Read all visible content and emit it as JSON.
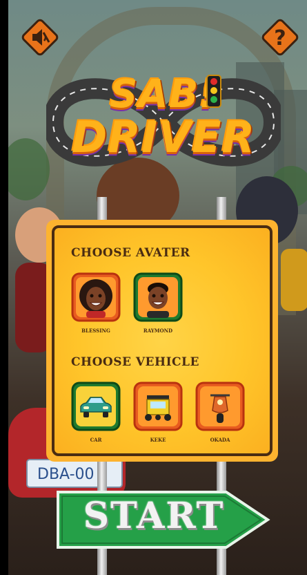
{
  "colors": {
    "board": "#fdb32f",
    "board_border": "#4a2c12",
    "start_green": "#25a048",
    "icon_orange": "#e8731a"
  },
  "top_bar": {
    "sound_button_icon": "speaker-muted-icon",
    "help_button_icon": "question-mark-icon",
    "help_glyph": "?"
  },
  "logo": {
    "line1": "SAB!",
    "line2": "DRIVER"
  },
  "background": {
    "plate_text": "DBA-00"
  },
  "avatar_section": {
    "title": "CHOOSE AVATER",
    "options": [
      {
        "label": "BLESSING",
        "selected": false
      },
      {
        "label": "RAYMOND",
        "selected": true
      }
    ]
  },
  "vehicle_section": {
    "title": "CHOOSE VEHICLE",
    "options": [
      {
        "label": "CAR",
        "selected": true
      },
      {
        "label": "KEKE",
        "selected": false
      },
      {
        "label": "OKADA",
        "selected": false
      }
    ]
  },
  "start_button": {
    "label": "START"
  }
}
